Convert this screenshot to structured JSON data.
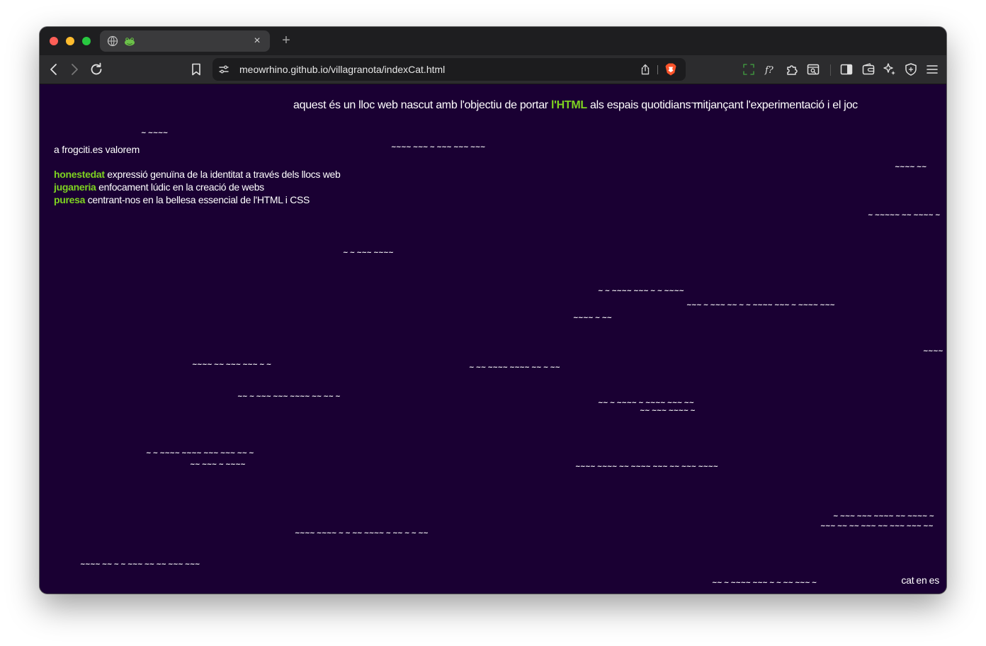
{
  "browser": {
    "url": "meowrhino.github.io/villagranota/indexCat.html",
    "tab_close": "×",
    "new_tab": "+"
  },
  "colors": {
    "page_background": "#1a0033",
    "highlight": "#7ed321",
    "text": "#ffffff"
  },
  "page": {
    "headline": {
      "before": "aquest és un lloc web nascut amb l'objectiu de portar ",
      "highlight": "l'HTML",
      "after": " als espais quotidians mitjançant l'experimentació i el joc"
    },
    "intro": "a frogciti.es valorem",
    "values": [
      {
        "keyword": "honestedat",
        "text": " expressió genuïna de la identitat a través dels llocs web"
      },
      {
        "keyword": "juganeria",
        "text": " enfocament lúdic en la creació de webs"
      },
      {
        "keyword": "puresa",
        "text": " centrant-nos en la bellesa essencial de l'HTML i CSS"
      }
    ],
    "languages": [
      "cat",
      "en",
      "es"
    ]
  },
  "waves": [
    "~~ ~",
    "~ ~~~~",
    "~~~~ ~~~ ~ ~~~ ~~~ ~~~",
    "~~~~ ~~",
    "~ ~~~~~ ~~ ~~~~ ~",
    "~ ~ ~~~ ~~~~",
    "~ ~ ~~~~ ~~~ ~ ~ ~~~~",
    "~~~ ~ ~~~ ~~ ~ ~ ~~~~ ~~~ ~ ~~~~ ~~~",
    "~~~~ ~ ~~",
    "~~~~",
    "~~~~ ~~ ~~~ ~~~ ~ ~",
    "~ ~~ ~~~~ ~~~~ ~~ ~ ~~",
    "~~ ~ ~~~ ~~~ ~~~~ ~~ ~~ ~",
    "~~ ~ ~~~~ ~ ~~~~ ~~~ ~~",
    "~~ ~~~ ~~~~ ~",
    "~ ~ ~~~~ ~~~~ ~~~ ~~~ ~~ ~",
    "~~ ~~~ ~ ~~~~",
    "~~~~ ~~~~ ~~ ~~~~ ~~~ ~~ ~~~ ~~~~",
    "~ ~~~ ~~~ ~~~~ ~~ ~~~~ ~",
    "~~~ ~~ ~~ ~~~ ~~ ~~~ ~~~ ~~",
    "~~~~ ~~~~ ~ ~ ~~ ~~~~ ~ ~~ ~ ~ ~~",
    "~~~~ ~~ ~ ~ ~~~ ~~ ~~ ~~~ ~~~",
    "~~ ~ ~~~~ ~~~ ~ ~ ~~ ~~~ ~"
  ]
}
